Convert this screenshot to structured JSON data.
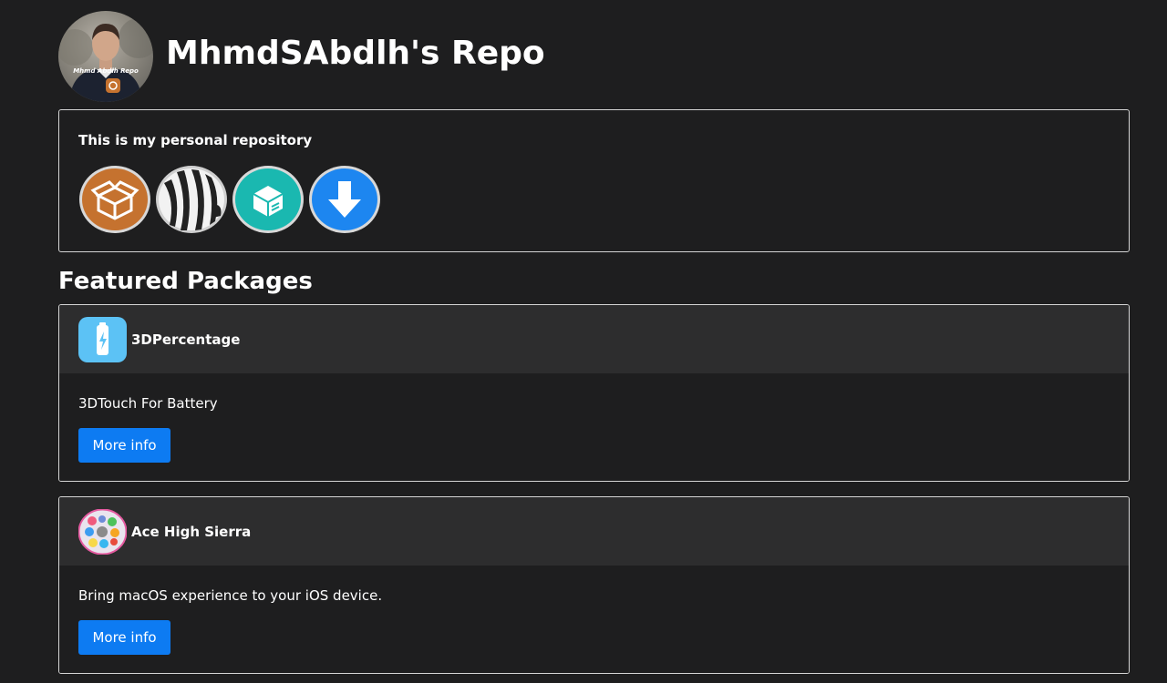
{
  "header": {
    "title": "MhmdSAbdlh's Repo",
    "avatar_caption": "Mhmd Abdlh Repo",
    "avatar_icon": "person-photo"
  },
  "intro": {
    "text": "This is my personal repository",
    "app_icons": [
      {
        "icon": "cydia-icon",
        "color": "#c5722f"
      },
      {
        "icon": "zebra-icon",
        "color": "#2b2b2b"
      },
      {
        "icon": "sileo-icon",
        "color": "#1ab8b0"
      },
      {
        "icon": "installer-icon",
        "color": "#1d86f0"
      }
    ]
  },
  "featured": {
    "title": "Featured Packages",
    "packages": [
      {
        "name": "3DPercentage",
        "description": "3DTouch For Battery",
        "button_label": "More info",
        "icon": "battery-icon"
      },
      {
        "name": "Ace High Sierra",
        "description": "Bring macOS experience to your iOS device.",
        "button_label": "More info",
        "icon": "macos-apps-icon"
      }
    ]
  },
  "colors": {
    "background": "#1e1e1f",
    "card_header": "#2d2d2e",
    "border": "#d5d5d5",
    "button": "#0d7bf2"
  }
}
